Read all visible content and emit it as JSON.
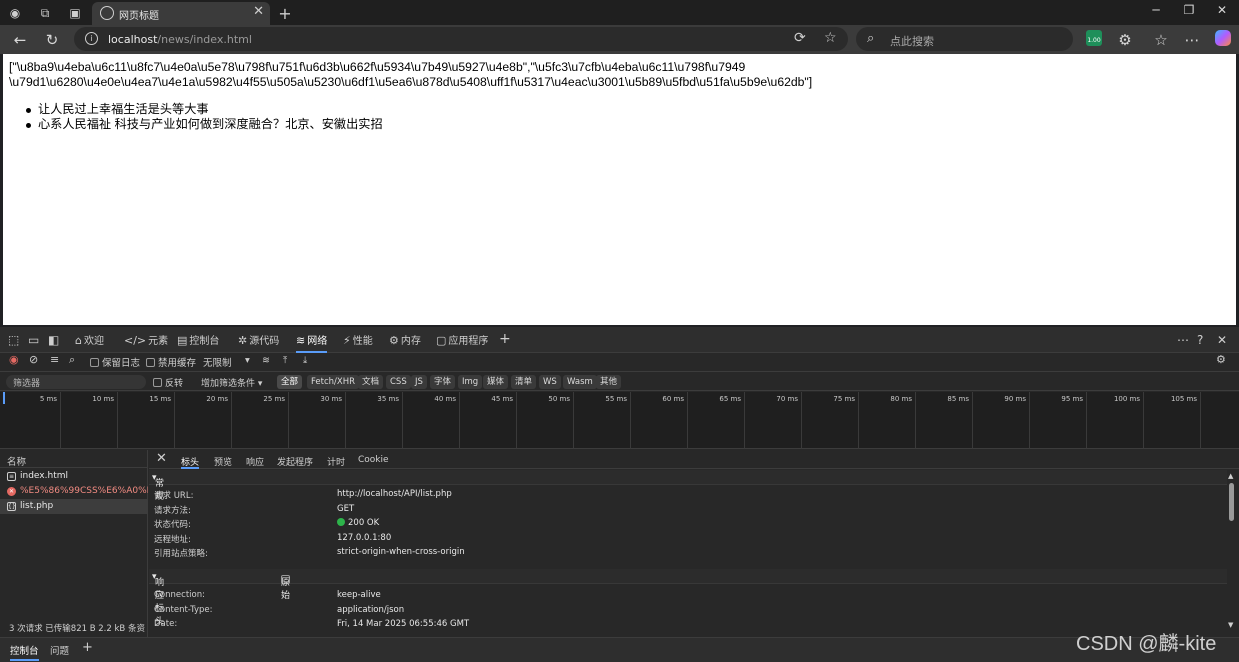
{
  "browser": {
    "tab_title": "网页标题",
    "url_host": "localhost",
    "url_path": "/news/index.html",
    "search_placeholder": "点此搜索",
    "copilot_badge": "1.00"
  },
  "page": {
    "json_line_1": "[\"\\u8ba9\\u4eba\\u6c11\\u8fc7\\u4e0a\\u5e78\\u798f\\u751f\\u6d3b\\u662f\\u5934\\u7b49\\u5927\\u4e8b\",\"\\u5fc3\\u7cfb\\u4eba\\u6c11\\u798f\\u7949",
    "json_line_2": "\\u79d1\\u6280\\u4e0e\\u4ea7\\u4e1a\\u5982\\u4f55\\u505a\\u5230\\u6df1\\u5ea6\\u878d\\u5408\\uff1f\\u5317\\u4eac\\u3001\\u5b89\\u5fbd\\u51fa\\u5b9e\\u62db\"]",
    "news_items": [
      "让人民过上幸福生活是头等大事",
      "心系人民福祉 科技与产业如何做到深度融合？北京、安徽出实招"
    ]
  },
  "devtools": {
    "tabs": [
      {
        "label": "欢迎",
        "icon": "home-icon"
      },
      {
        "label": "元素",
        "icon": "code-icon"
      },
      {
        "label": "控制台",
        "icon": "console-icon"
      },
      {
        "label": "源代码",
        "icon": "bug-icon"
      },
      {
        "label": "网络",
        "icon": "wifi-icon"
      },
      {
        "label": "性能",
        "icon": "performance-icon"
      },
      {
        "label": "内存",
        "icon": "memory-icon"
      },
      {
        "label": "应用程序",
        "icon": "application-icon"
      }
    ],
    "network_toolbar": {
      "preserve_log": "保留日志",
      "disable_cache": "禁用缓存",
      "throttle": "无限制"
    },
    "filter": {
      "placeholder": "筛选器",
      "invert": "反转",
      "more_filters": "增加筛选条件",
      "chips": [
        "全部",
        "Fetch/XHR",
        "文档",
        "CSS",
        "JS",
        "字体",
        "Img",
        "媒体",
        "清单",
        "WS",
        "Wasm",
        "其他"
      ]
    },
    "timeline_ticks": [
      "5 ms",
      "10 ms",
      "15 ms",
      "20 ms",
      "25 ms",
      "30 ms",
      "35 ms",
      "40 ms",
      "45 ms",
      "50 ms",
      "55 ms",
      "60 ms",
      "65 ms",
      "70 ms",
      "75 ms",
      "80 ms",
      "85 ms",
      "90 ms",
      "95 ms",
      "100 ms",
      "105 ms"
    ],
    "requests": {
      "header": "名称",
      "items": [
        "index.html",
        "%E5%86%99CSS%E6%A0%B7...",
        "list.php"
      ],
      "status": "3 次请求   已传输821 B   2.2 kB 条资"
    },
    "details": {
      "tabs": [
        "标头",
        "预览",
        "响应",
        "发起程序",
        "计时",
        "Cookie"
      ],
      "general_title": "常规",
      "general": [
        {
          "k": "请求 URL:",
          "v": "http://localhost/API/list.php"
        },
        {
          "k": "请求方法:",
          "v": "GET"
        },
        {
          "k": "状态代码:",
          "v": "200 OK"
        },
        {
          "k": "远程地址:",
          "v": "127.0.0.1:80"
        },
        {
          "k": "引用站点策略:",
          "v": "strict-origin-when-cross-origin"
        }
      ],
      "response_title": "响应标头",
      "raw_label": "原始",
      "response": [
        {
          "k": "Connection:",
          "v": "keep-alive"
        },
        {
          "k": "Content-Type:",
          "v": "application/json"
        },
        {
          "k": "Date:",
          "v": "Fri, 14 Mar 2025 06:55:46 GMT"
        }
      ]
    },
    "drawer": {
      "tabs": [
        "控制台",
        "问题"
      ]
    }
  },
  "watermark": "CSDN @麟-kite"
}
